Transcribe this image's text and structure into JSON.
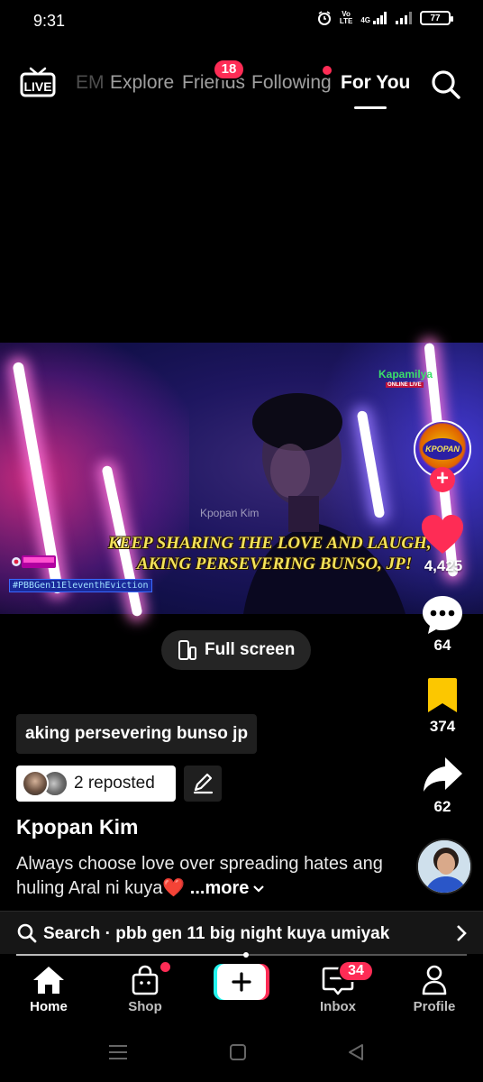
{
  "status_bar": {
    "time": "9:31",
    "volte": "Vo\nLTE",
    "network": "4G",
    "battery": "77"
  },
  "top_nav": {
    "cut_tab": "EM",
    "tabs": [
      "Explore",
      "Friends",
      "Following",
      "For You"
    ],
    "active_tab": "For You",
    "friends_badge": "18",
    "icons": {
      "live": "live-tv-icon",
      "search": "search-icon"
    }
  },
  "video": {
    "channel_watermark": "Kpopan Kim",
    "caption_line_1": "KEEP SHARING THE LOVE AND LAUGH,",
    "caption_line_2": "AKING PERSEVERING BUNSO, JP!",
    "broadcaster_logo": "Kapamilya",
    "broadcaster_sub": "ONLINE LIVE",
    "creator_logo_text": "KPOPAN",
    "hashtag": "#PBBGen11EleventhEviction"
  },
  "actions": {
    "likes": "4,425",
    "comments": "64",
    "bookmarks": "374",
    "shares": "62",
    "accent_color": "#fe2c55",
    "bookmark_color": "#fcc700"
  },
  "fullscreen": {
    "label": "Full screen"
  },
  "post": {
    "search_tag": "aking persevering bunso jp",
    "repost_label": "2 reposted",
    "username": "Kpopan Kim",
    "caption": "Always choose love over spreading hates ang huling Aral ni kuya",
    "caption_emoji": "❤️",
    "more_label": " ...more"
  },
  "search_bar": {
    "text": "Search · pbb gen 11 big night kuya umiyak",
    "progress": 0.51
  },
  "bottom_tabs": {
    "items": [
      "Home",
      "Shop",
      "Inbox",
      "Profile"
    ],
    "active": "Home",
    "inbox_badge": "34"
  }
}
